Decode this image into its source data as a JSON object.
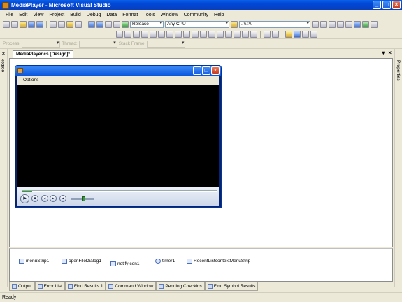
{
  "window": {
    "title": "MediaPlayer - Microsoft Visual Studio"
  },
  "menu": [
    "File",
    "Edit",
    "View",
    "Project",
    "Build",
    "Debug",
    "Data",
    "Format",
    "Tools",
    "Window",
    "Community",
    "Help"
  ],
  "toolbar": {
    "config": "Release",
    "platform": "Any CPU",
    "find_text": ".:\\\\.:\\\\",
    "process_label": "Process:",
    "thread_label": "Thread:",
    "stackframe_label": "Stack Frame:"
  },
  "side": {
    "toolbox": "Toolbox",
    "properties": "Properties"
  },
  "document": {
    "tab": "MediaPlayer.cs [Design]*"
  },
  "form": {
    "menu_label": "Options",
    "seek_progress": 0.05,
    "volume_level": 0.55
  },
  "tray": [
    "menuStrip1",
    "openFileDialog1",
    "notifyIcon1",
    "timer1",
    "RecentListcontextMenuStrip"
  ],
  "bottom_tabs": [
    "Output",
    "Error List",
    "Find Results 1",
    "Command Window",
    "Pending Checkins",
    "Find Symbol Results"
  ],
  "status": {
    "text": "Ready"
  }
}
